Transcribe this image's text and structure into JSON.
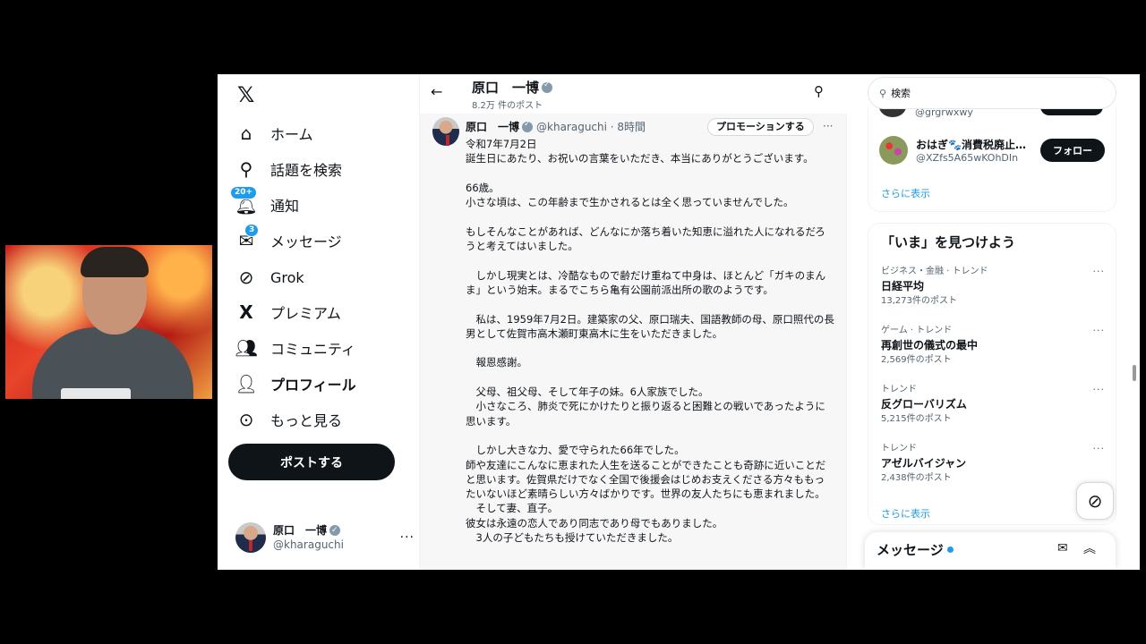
{
  "nav": {
    "items": [
      {
        "label": "ホーム",
        "icon": "home-icon"
      },
      {
        "label": "話題を検索",
        "icon": "search-icon"
      },
      {
        "label": "通知",
        "icon": "bell-icon",
        "badge": "20+"
      },
      {
        "label": "メッセージ",
        "icon": "envelope-icon",
        "badge": "3"
      },
      {
        "label": "Grok",
        "icon": "grok-icon"
      },
      {
        "label": "プレミアム",
        "icon": "x-icon"
      },
      {
        "label": "コミュニティ",
        "icon": "people-icon"
      },
      {
        "label": "プロフィール",
        "icon": "person-icon"
      },
      {
        "label": "もっと見る",
        "icon": "more-circle-icon"
      }
    ],
    "post_label": "ポストする",
    "account": {
      "name": "原口　一博",
      "handle": "@kharaguchi",
      "more": "···"
    }
  },
  "header": {
    "title": "原口　一博",
    "subtitle": "8.2万 件のポスト"
  },
  "tweet": {
    "name": "原口　一博",
    "handle_time": "@kharaguchi · 8時間",
    "promo_label": "プロモーションする",
    "more": "···",
    "body": "令和7年7月2日\n誕生日にあたり、お祝いの言葉をいただき、本当にありがとうございます。\n\n66歳。\n小さな頃は、この年齢まで生かされるとは全く思っていませんでした。\n\nもしそんなことがあれば、どんなにか落ち着いた知恵に溢れた人になれるだろうと考えてはいました。\n\n　しかし現実とは、冷酷なもので齢だけ重ねて中身は、ほとんど「ガキのまんま」という始末。まるでこちら亀有公園前派出所の歌のようです。\n\n　私は、1959年7月2日。建築家の父、原口瑞夫、国語教師の母、原口照代の長男として佐賀市高木瀬町東高木に生をいただきました。\n\n　報恩感謝。\n\n　父母、祖父母、そして年子の妹。6人家族でした。\n　小さなころ、肺炎で死にかけたりと振り返ると困難との戦いであったように思います。\n\n　しかし大きな力、愛で守られた66年でした。\n師や友達にこんなに恵まれた人生を送ることができたことも奇跡に近いことだと思います。佐賀県だけでなく全国で後援会はじめお支えくださる方々ももったいないほど素晴らしい方々ばかりです。世界の友人たちにも恵まれました。\n　そして妻、直子。\n彼女は永遠の恋人であり同志であり母でもありました。\n　3人の子どもたちも授けていただきました。"
  },
  "right": {
    "search_placeholder": "検索",
    "partial_handle": "@grgrwxwy",
    "who_to_follow": {
      "name": "おはぎ🐾消費税廃止…",
      "handle": "@XZfs5A65wKOhDIn",
      "follow_label": "フォロー"
    },
    "show_more": "さらに表示",
    "trends_title": "「いま」を見つけよう",
    "trends": [
      {
        "category": "ビジネス・金融 · トレンド",
        "title": "日経平均",
        "count": "13,273件のポスト"
      },
      {
        "category": "ゲーム · トレンド",
        "title": "再創世の儀式の最中",
        "count": "2,569件のポスト"
      },
      {
        "category": "トレンド",
        "title": "反グローバリズム",
        "count": "5,215件のポスト"
      },
      {
        "category": "トレンド",
        "title": "アゼルバイジャン",
        "count": "2,438件のポスト"
      }
    ],
    "trends_show_more": "さらに表示",
    "messages_label": "メッセージ"
  }
}
